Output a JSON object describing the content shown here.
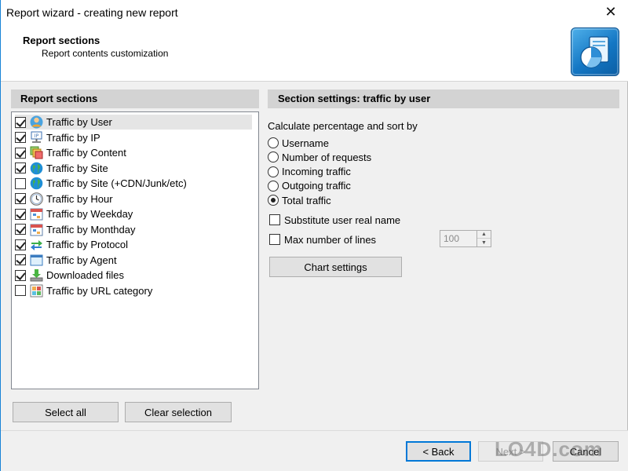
{
  "window": {
    "title": "Report wizard - creating new report"
  },
  "header": {
    "title": "Report sections",
    "subtitle": "Report contents customization"
  },
  "left_panel": {
    "heading": "Report sections",
    "items": [
      {
        "label": "Traffic by User",
        "checked": true,
        "icon": "user-icon",
        "selected": true
      },
      {
        "label": "Traffic by IP",
        "checked": true,
        "icon": "ip-icon"
      },
      {
        "label": "Traffic by Content",
        "checked": true,
        "icon": "content-icon"
      },
      {
        "label": "Traffic by Site",
        "checked": true,
        "icon": "globe-icon"
      },
      {
        "label": "Traffic by Site (+CDN/Junk/etc)",
        "checked": false,
        "icon": "globe-icon"
      },
      {
        "label": "Traffic by Hour",
        "checked": true,
        "icon": "clock-icon"
      },
      {
        "label": "Traffic by Weekday",
        "checked": true,
        "icon": "calendar-icon"
      },
      {
        "label": "Traffic by Monthday",
        "checked": true,
        "icon": "calendar-icon"
      },
      {
        "label": "Traffic by Protocol",
        "checked": true,
        "icon": "protocol-arrows-icon"
      },
      {
        "label": "Traffic by Agent",
        "checked": true,
        "icon": "browser-window-icon"
      },
      {
        "label": "Downloaded files",
        "checked": true,
        "icon": "download-icon"
      },
      {
        "label": "Traffic by URL category",
        "checked": false,
        "icon": "category-icon"
      }
    ],
    "select_all_label": "Select all",
    "clear_selection_label": "Clear selection"
  },
  "right_panel": {
    "heading": "Section settings: traffic by user",
    "sort_label": "Calculate percentage and sort by",
    "sort_options": [
      {
        "label": "Username",
        "selected": false
      },
      {
        "label": "Number of requests",
        "selected": false
      },
      {
        "label": "Incoming traffic",
        "selected": false
      },
      {
        "label": "Outgoing traffic",
        "selected": false
      },
      {
        "label": "Total traffic",
        "selected": true
      }
    ],
    "substitute_label": "Substitute user real name",
    "substitute_checked": false,
    "max_lines_label": "Max number of lines",
    "max_lines_checked": false,
    "max_lines_value": "100",
    "chart_settings_label": "Chart settings"
  },
  "footer": {
    "back_label": "< Back",
    "next_label": "Next >",
    "cancel_label": "Cancel"
  },
  "watermark": "LO4D.com"
}
